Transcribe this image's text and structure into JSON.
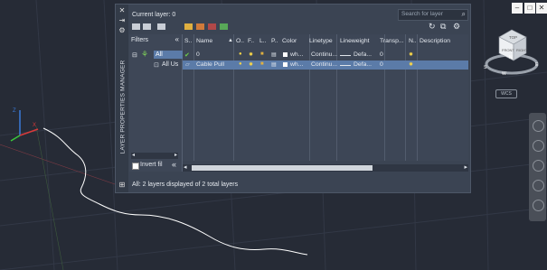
{
  "window_buttons": [
    "–",
    "□",
    "✕"
  ],
  "palette": {
    "side_title": "LAYER PROPERTIES MANAGER",
    "current_layer": "Current layer: 0",
    "search_placeholder": "Search for layer",
    "filters_header": "Filters",
    "filters_collapse": "«",
    "tree": {
      "root": "All",
      "child": "All Us"
    },
    "invert_filter": "Invert fil",
    "invert_chev": "«",
    "columns": [
      "S..",
      "Name",
      "O..",
      "F..",
      "L..",
      "P..",
      "Color",
      "Linetype",
      "Lineweight",
      "Transp...",
      "N..",
      "Description"
    ],
    "rows": [
      {
        "name": "0",
        "color": "wh...",
        "linetype": "Continu...",
        "lineweight": "Defa...",
        "transparency": "0",
        "selected": false
      },
      {
        "name": "Cable Pull",
        "color": "wh...",
        "linetype": "Continu...",
        "lineweight": "Defa...",
        "transparency": "0",
        "selected": true
      }
    ],
    "status": "All: 2 layers displayed of 2 total layers"
  },
  "viewcube": {
    "top": "TOP",
    "front": "FRONT",
    "right": "RIGHT",
    "compass": [
      "N",
      "E",
      "S",
      "W"
    ]
  },
  "wcs_label": "WCS",
  "colors": {
    "accent_selected": "#5b7ba8",
    "background": "#262b36",
    "panel": "#3b4453"
  }
}
